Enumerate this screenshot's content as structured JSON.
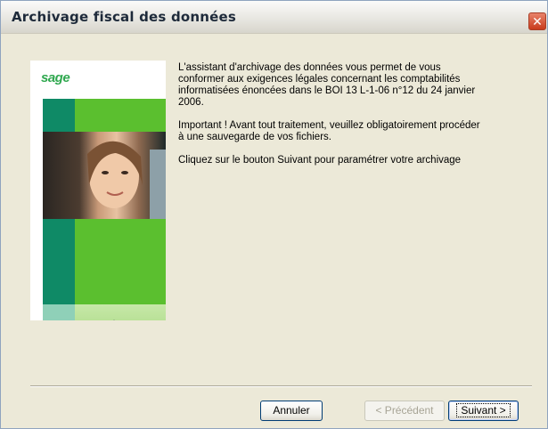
{
  "window": {
    "title": "Archivage fiscal des données",
    "close_glyph": "✕"
  },
  "side_image": {
    "logo": "sage",
    "description_icon": "archive-disk-icon"
  },
  "content": {
    "paragraph1": "L'assistant d'archivage des données vous permet de vous\nconformer aux exigences légales concernant les comptabilités\ninformatisées énoncées dans le BOI 13 L-1-06 n°12 du 24 janvier\n2006.",
    "paragraph2": "Important ! Avant tout traitement, veuillez obligatoirement procéder\nà une sauvegarde de vos fichiers.",
    "paragraph3": "Cliquez sur le bouton Suivant pour paramétrer votre archivage"
  },
  "buttons": {
    "cancel": "Annuler",
    "previous": "< Précédent",
    "next": "Suivant >"
  },
  "colors": {
    "accent_green": "#5bbf2f",
    "dark_green": "#0f8a66",
    "title_close": "#c93b1c"
  }
}
